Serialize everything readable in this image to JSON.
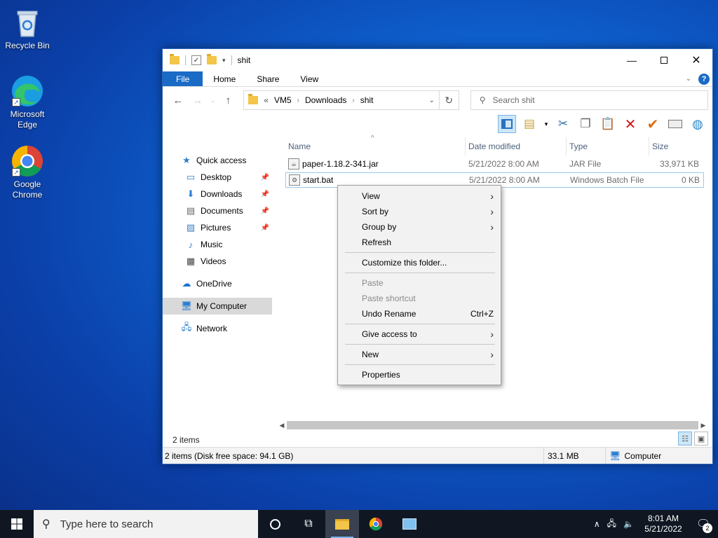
{
  "desktop": {
    "icons": [
      {
        "label": "Recycle Bin"
      },
      {
        "label": "Microsoft\nEdge"
      },
      {
        "label": "Google\nChrome"
      }
    ]
  },
  "window": {
    "title": "shit",
    "ribbon_tabs": [
      "File",
      "Home",
      "Share",
      "View"
    ],
    "address": {
      "overflow": "«",
      "crumbs": [
        "VM5",
        "Downloads",
        "shit"
      ]
    },
    "search_placeholder": "Search shit"
  },
  "nav_pane": {
    "quick_access": "Quick access",
    "pinned": [
      "Desktop",
      "Downloads",
      "Documents",
      "Pictures"
    ],
    "unpinned": [
      "Music",
      "Videos"
    ],
    "onedrive": "OneDrive",
    "my_computer": "My Computer",
    "network": "Network"
  },
  "columns": {
    "name": "Name",
    "date": "Date modified",
    "type": "Type",
    "size": "Size"
  },
  "files": [
    {
      "name": "paper-1.18.2-341.jar",
      "date": "5/21/2022 8:00 AM",
      "type": "JAR File",
      "size": "33,971 KB"
    },
    {
      "name": "start.bat",
      "date": "5/21/2022 8:00 AM",
      "type": "Windows Batch File",
      "size": "0 KB"
    }
  ],
  "context_menu": {
    "view": "View",
    "sort_by": "Sort by",
    "group_by": "Group by",
    "refresh": "Refresh",
    "customize": "Customize this folder...",
    "paste": "Paste",
    "paste_shortcut": "Paste shortcut",
    "undo_rename": "Undo Rename",
    "undo_shortcut": "Ctrl+Z",
    "give_access": "Give access to",
    "new": "New",
    "properties": "Properties"
  },
  "status": {
    "item_count": "2 items",
    "disk_info": "2 items (Disk free space: 94.1 GB)",
    "total_size": "33.1 MB",
    "location": "Computer"
  },
  "taskbar": {
    "search_placeholder": "Type here to search",
    "time": "8:01 AM",
    "date": "5/21/2022",
    "notification_count": "2"
  }
}
